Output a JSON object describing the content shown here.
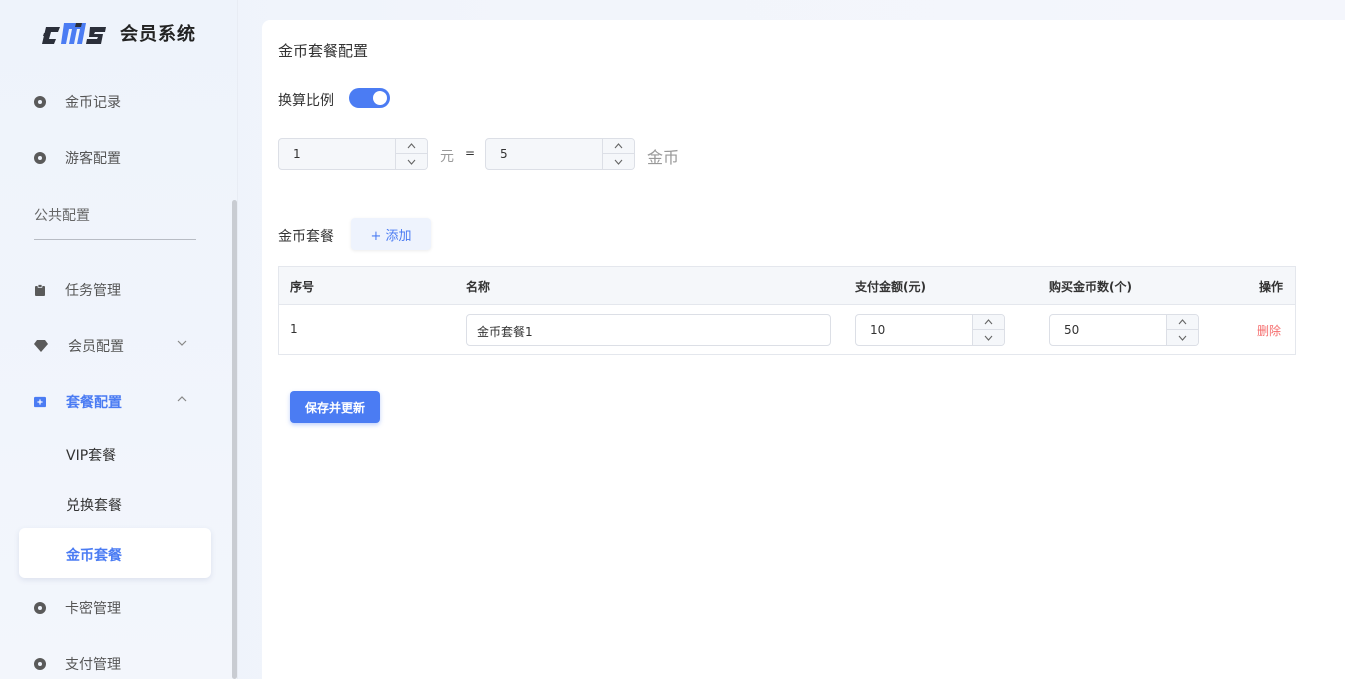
{
  "app": {
    "logo_text": "会员系统"
  },
  "sidebar": {
    "items": [
      {
        "label": "金币记录",
        "icon": "circle-dot-icon"
      },
      {
        "label": "游客配置",
        "icon": "circle-dot-icon"
      }
    ],
    "group_label": "公共配置",
    "group_items": [
      {
        "label": "任务管理",
        "icon": "clipboard-icon"
      },
      {
        "label": "会员配置",
        "icon": "diamond-icon",
        "expanded": false
      },
      {
        "label": "套餐配置",
        "icon": "plus-square-icon",
        "expanded": true,
        "active": true
      }
    ],
    "sub_items": [
      {
        "label": "VIP套餐"
      },
      {
        "label": "兑换套餐"
      },
      {
        "label": "金币套餐",
        "active": true
      }
    ],
    "more_items": [
      {
        "label": "卡密管理",
        "icon": "circle-dot-icon"
      },
      {
        "label": "支付管理",
        "icon": "circle-dot-icon"
      }
    ]
  },
  "main": {
    "title": "金币套餐配置",
    "ratio": {
      "label": "换算比例",
      "enabled": true,
      "yuan_value": "1",
      "yuan_unit": "元",
      "equals": "=",
      "coin_value": "5",
      "coin_unit": "金币"
    },
    "packages": {
      "label": "金币套餐",
      "add_button": "+ 添加",
      "columns": [
        "序号",
        "名称",
        "支付金额(元)",
        "购买金币数(个)",
        "操作"
      ],
      "rows": [
        {
          "index": "1",
          "name": "金币套餐1",
          "price": "10",
          "coins": "50",
          "action": "删除"
        }
      ]
    },
    "save_button": "保存并更新"
  },
  "colors": {
    "accent": "#4b7cf3",
    "danger": "#f56c6c",
    "panel_bg": "#ffffff"
  }
}
